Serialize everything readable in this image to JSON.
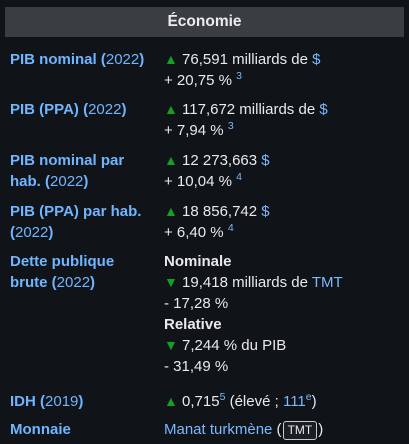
{
  "header": {
    "title": "Économie"
  },
  "rows": {
    "pib_nominal": {
      "label": "PIB nominal",
      "year": "2022",
      "value": "76,591 milliards de",
      "currency": "$",
      "growth": "+ 20,75 %",
      "ref": "3"
    },
    "pib_ppa": {
      "label": "PIB (PPA)",
      "year": "2022",
      "value": "117,672 milliards de",
      "currency": "$",
      "growth": "+ 7,94 %",
      "ref": "3"
    },
    "pib_nominal_hab": {
      "label1": "PIB nominal par",
      "label2": "hab.",
      "year": "2022",
      "value": "12 273,663",
      "currency": "$",
      "growth": "+ 10,04 %",
      "ref": "4"
    },
    "pib_ppa_hab": {
      "label": "PIB (PPA) par hab.",
      "year": "2022",
      "value": "18 856,742",
      "currency": "$",
      "growth": "+ 6,40 %",
      "ref": "4"
    },
    "dette": {
      "label1": "Dette publique",
      "label2": "brute",
      "year": "2022",
      "nominale_title": "Nominale",
      "nominale_value": "19,418 milliards de",
      "nominale_currency": "TMT",
      "nominale_growth": "- 17,28 %",
      "relative_title": "Relative",
      "relative_value": "7,244 % du PIB",
      "relative_growth": "- 31,49 %"
    },
    "idh": {
      "label": "IDH",
      "year": "2019",
      "value": "0,715",
      "ref": "5",
      "detail_pre": "(élevé ;",
      "rank": "111",
      "rank_sup": "e",
      "detail_post": ")"
    },
    "monnaie": {
      "label": "Monnaie",
      "value": "Manat turkmène",
      "abbr": "TMT"
    }
  },
  "colors": {
    "background": "#101418",
    "header": "#3a3d42",
    "label": "#6fb5ff",
    "arrow": "#14a020"
  }
}
